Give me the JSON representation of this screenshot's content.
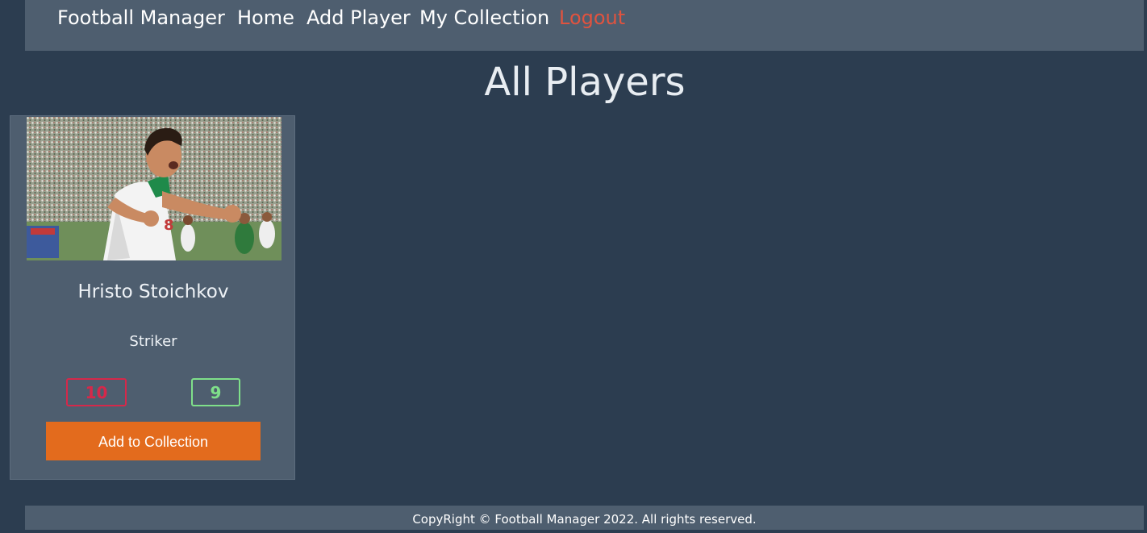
{
  "nav": {
    "brand": "Football Manager",
    "home": "Home",
    "add_player": "Add Player",
    "my_collection": "My Collection",
    "logout": "Logout"
  },
  "page": {
    "title": "All Players"
  },
  "players": [
    {
      "name": "Hristo Stoichkov",
      "position": "Striker",
      "stat_red": "10",
      "stat_green": "9",
      "add_label": "Add to Collection"
    }
  ],
  "colors": {
    "background": "#2c3d50",
    "panel": "#4e5e6f",
    "logout": "#e0533f",
    "stat_red": "#d6284a",
    "stat_green": "#7fe08a",
    "button": "#e36b1d"
  },
  "footer": {
    "text": "CopyRight © Football Manager 2022. All rights reserved."
  }
}
